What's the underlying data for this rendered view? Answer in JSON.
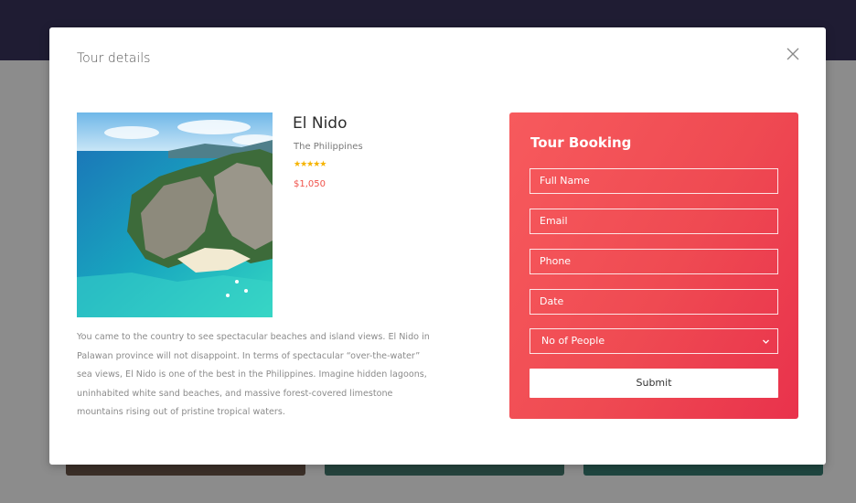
{
  "modal": {
    "title": "Tour details"
  },
  "tour": {
    "name": "El Nido",
    "location": "The Philippines",
    "rating": 5,
    "price": "$1,050",
    "description": "You came to the country to see spectacular beaches and island views. El Nido in Palawan province will not disappoint. In terms of spectacular “over-the-water” sea views, El Nido is one of the best in the Philippines. Imagine hidden lagoons, uninhabited white sand beaches, and massive forest-covered limestone mountains rising out of pristine tropical waters."
  },
  "booking": {
    "title": "Tour Booking",
    "full_name_placeholder": "Full Name",
    "email_placeholder": "Email",
    "phone_placeholder": "Phone",
    "date_placeholder": "Date",
    "people_select_value": "No of People",
    "submit_label": "Submit"
  },
  "colors": {
    "accent_start": "#f75a5d",
    "accent_end": "#e9324c",
    "price": "#f0524a",
    "star": "#f5b300",
    "page_top_band": "#1f1c33"
  },
  "icons": {
    "close": "close-icon",
    "select": "chevron-down-icon",
    "rating": "star-icon"
  }
}
